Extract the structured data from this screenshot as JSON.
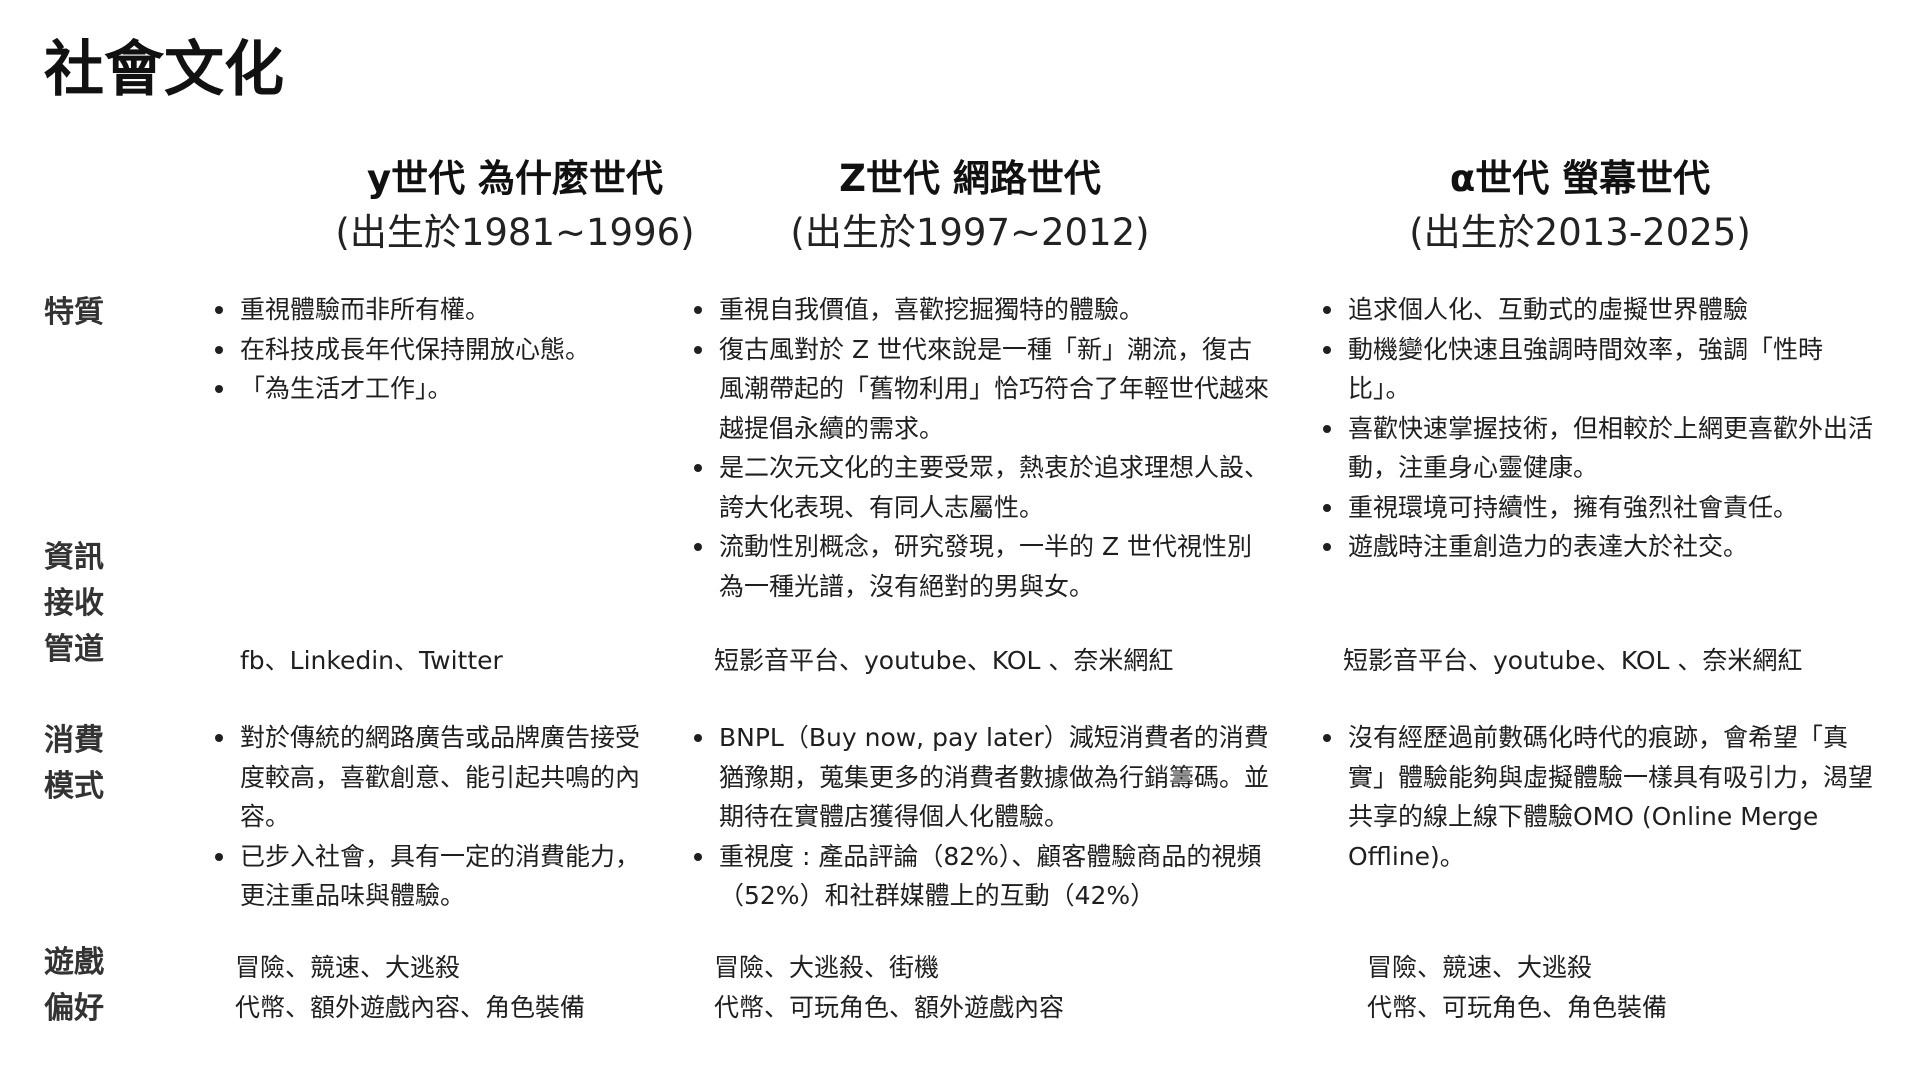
{
  "page": {
    "title": "社會文化"
  },
  "columns": [
    {
      "name": "y世代  為什麼世代",
      "years": "(出生於1981~1996)"
    },
    {
      "name": "Z世代  網路世代",
      "years": "(出生於1997~2012)"
    },
    {
      "name": "α世代  螢幕世代",
      "years": "(出生於2013-2025)"
    }
  ],
  "rows": {
    "traits": {
      "label": [
        "特質"
      ],
      "cells": [
        [
          "重視體驗而非所有權。",
          "在科技成長年代保持開放心態。",
          "「為生活才工作」。"
        ],
        [
          "重視自我價值，喜歡挖掘獨特的體驗。",
          "復古風對於 Z 世代來說是一種「新」潮流，復古風潮帶起的「舊物利用」恰巧符合了年輕世代越來越提倡永續的需求。",
          "是二次元文化的主要受眾，熱衷於追求理想人設、誇大化表現、有同人志屬性。",
          "流動性別概念，研究發現，一半的 Z 世代視性別為一種光譜，沒有絕對的男與女。"
        ],
        [
          "追求個人化、互動式的虛擬世界體驗",
          "動機變化快速且強調時間效率，強調「性時比」。",
          "喜歡快速掌握技術，但相較於上網更喜歡外出活動，注重身心靈健康。",
          "重視環境可持續性，擁有強烈社會責任。",
          "遊戲時注重創造力的表達大於社交。"
        ]
      ]
    },
    "info_channels": {
      "label": [
        "資訊",
        "接收",
        "管道"
      ],
      "cells": [
        "fb、Linkedin、Twitter",
        "短影音平台、youtube、KOL 、奈米網紅",
        "短影音平台、youtube、KOL 、奈米網紅"
      ]
    },
    "consumption": {
      "label": [
        "消費",
        "模式"
      ],
      "cells": [
        [
          "對於傳統的網路廣告或品牌廣告接受度較高，喜歡創意、能引起共鳴的內容。",
          "已步入社會，具有一定的消費能力，更注重品味與體驗。"
        ],
        [
          "BNPL（Buy now, pay later）減短消費者的消費猶豫期，蒐集更多的消費者數據做為行銷籌碼。並期待在實體店獲得個人化體驗。",
          "重視度 : 產品評論（82%）、顧客體驗商品的視頻（52%）和社群媒體上的互動（42%）"
        ],
        [
          "沒有經歷過前數碼化時代的痕跡，會希望「真實」體驗能夠與虛擬體驗一樣具有吸引力，渴望共享的線上線下體驗OMO (Online Merge Offline)。"
        ]
      ]
    },
    "gaming": {
      "label": [
        "遊戲",
        "偏好"
      ],
      "cells": [
        [
          "冒險、競速、大逃殺",
          "代幣、額外遊戲內容、角色裝備"
        ],
        [
          "冒險、大逃殺、街機",
          "代幣、可玩角色、額外遊戲內容"
        ],
        [
          "冒險、競速、大逃殺",
          "代幣、可玩角色、角色裝備"
        ]
      ]
    }
  }
}
